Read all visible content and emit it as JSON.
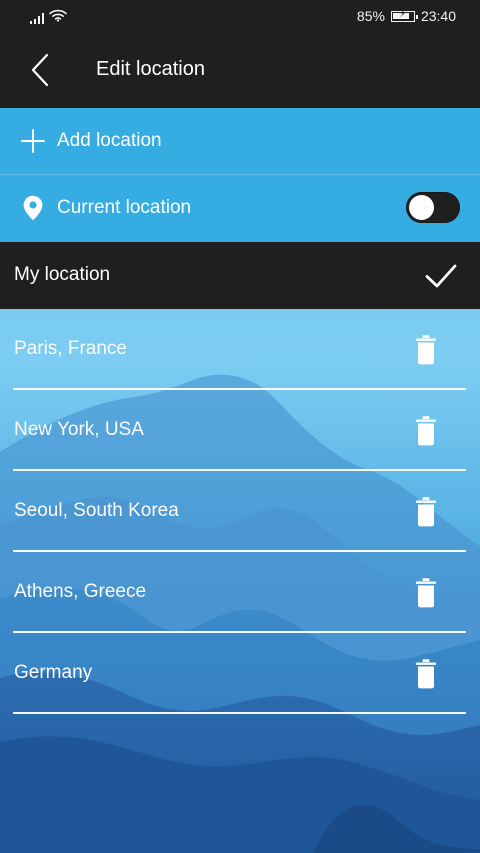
{
  "status_bar": {
    "battery_text": "85%",
    "battery_level": 0.85,
    "time": "23:40",
    "icons": [
      "signal-icon",
      "wifi-icon",
      "battery-icon"
    ]
  },
  "header": {
    "back_icon": "chevron-left-icon",
    "title": "Edit location"
  },
  "actions": {
    "add": {
      "icon": "plus-icon",
      "label": "Add location"
    },
    "current": {
      "icon": "location-pin-icon",
      "label": "Current location",
      "enabled": false
    }
  },
  "my_location": {
    "label": "My location",
    "icon": "check-icon"
  },
  "locations": [
    {
      "name": "Paris, France",
      "icon": "trash-icon"
    },
    {
      "name": "New York, USA",
      "icon": "trash-icon"
    },
    {
      "name": "Seoul, South Korea",
      "icon": "trash-icon"
    },
    {
      "name": "Athens, Greece",
      "icon": "trash-icon"
    },
    {
      "name": "Germany",
      "icon": "trash-icon"
    }
  ],
  "colors": {
    "dark": "#1f1f1f",
    "accent_blue": "#35ace2",
    "white": "#ffffff"
  }
}
